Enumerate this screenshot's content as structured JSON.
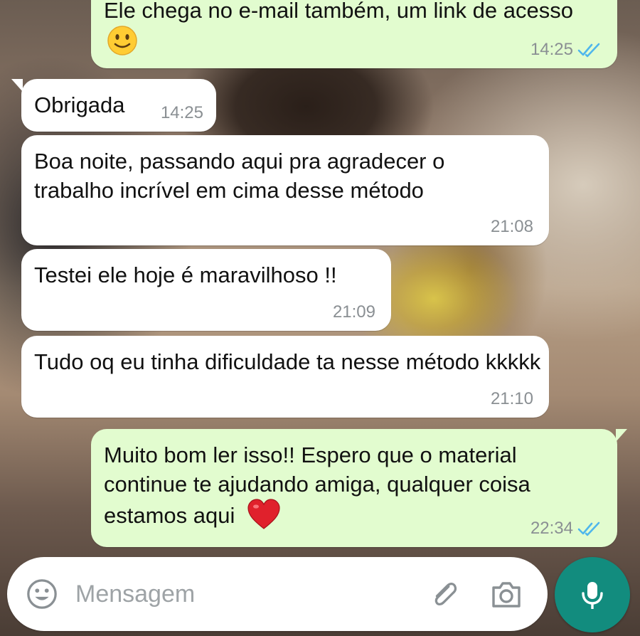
{
  "conversation": {
    "messages": [
      {
        "direction": "out",
        "text": "Ele chega no e-mail também, um link de acesso",
        "emoji": "slightly-smiling-face",
        "time": "14:25",
        "status_icon": "double-check-blue"
      },
      {
        "direction": "in",
        "text": "Obrigada",
        "time": "14:25"
      },
      {
        "direction": "in",
        "text": "Boa noite, passando aqui pra agradecer o trabalho incrível em cima desse método",
        "time": "21:08"
      },
      {
        "direction": "in",
        "text": "Testei ele hoje é maravilhoso !!",
        "time": "21:09"
      },
      {
        "direction": "in",
        "text": "Tudo oq eu tinha dificuldade ta nesse método kkkkk",
        "time": "21:10"
      },
      {
        "direction": "out",
        "text": "Muito bom ler isso!! Espero que o material continue te ajudando amiga, qualquer coisa estamos aqui",
        "emoji": "red-heart",
        "time": "22:34",
        "status_icon": "double-check-blue"
      }
    ]
  },
  "composer": {
    "placeholder": "Mensagem",
    "icons": [
      "emoji-icon",
      "paperclip-icon",
      "camera-icon",
      "microphone-icon"
    ]
  },
  "colors": {
    "incoming_bubble": "#ffffff",
    "outgoing_bubble": "#e2fccf",
    "read_ticks": "#4fb6ec",
    "mic_button": "#128c7e",
    "timestamp": "#8a8f93"
  }
}
